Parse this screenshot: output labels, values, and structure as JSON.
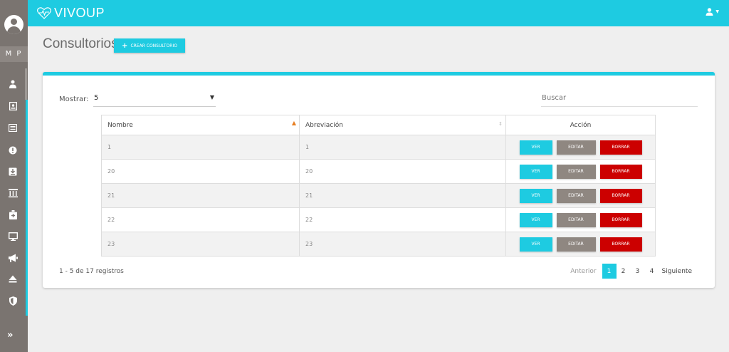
{
  "app": {
    "name": "VIVOUP"
  },
  "sidebar": {
    "initials": "M P",
    "items": [
      {
        "icon": "doctor-icon"
      },
      {
        "icon": "id-card-icon"
      },
      {
        "icon": "list-icon"
      },
      {
        "icon": "alert-icon"
      },
      {
        "icon": "download-box-icon"
      },
      {
        "icon": "building-icon"
      },
      {
        "icon": "medkit-icon"
      },
      {
        "icon": "monitor-icon"
      },
      {
        "icon": "megaphone-icon"
      },
      {
        "icon": "eject-icon"
      },
      {
        "icon": "shield-icon"
      }
    ],
    "expand_label": "»"
  },
  "header": {
    "title": "Consultorios",
    "create_label": "CREAR CONSULTORIO"
  },
  "table_controls": {
    "show_label": "Mostrar:",
    "show_value": "5",
    "search_placeholder": "Buscar"
  },
  "table": {
    "columns": [
      "Nombre",
      "Abreviación",
      "Acción"
    ],
    "rows": [
      {
        "nombre": "1",
        "abreviacion": "1"
      },
      {
        "nombre": "20",
        "abreviacion": "20"
      },
      {
        "nombre": "21",
        "abreviacion": "21"
      },
      {
        "nombre": "22",
        "abreviacion": "22"
      },
      {
        "nombre": "23",
        "abreviacion": "23"
      }
    ],
    "actions": {
      "view": "VER",
      "edit": "EDITAR",
      "delete": "BORRAR"
    }
  },
  "footer": {
    "records": "1 - 5 de 17 registros",
    "prev_label": "Anterior",
    "next_label": "Siguiente",
    "pages": [
      "1",
      "2",
      "3",
      "4"
    ],
    "current_page": "1"
  },
  "colors": {
    "accent": "#1ecbe1",
    "sidebar": "#7a7470",
    "edit": "#8f8781",
    "delete": "#cc0000"
  }
}
